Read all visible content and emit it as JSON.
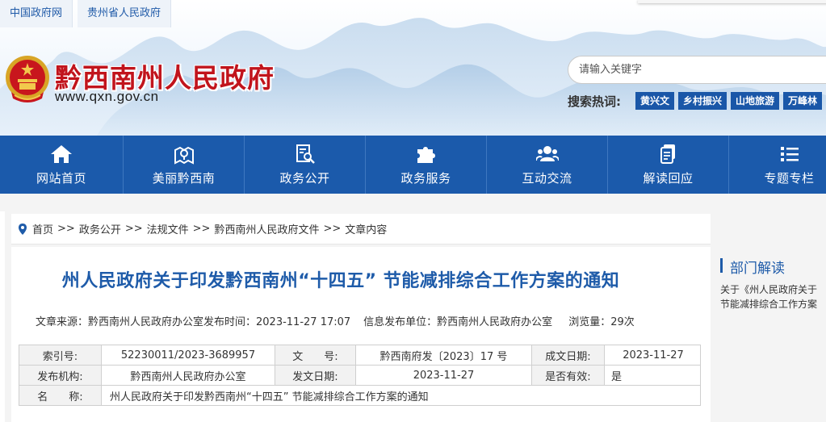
{
  "header": {
    "top_links": [
      "中国政府网",
      "贵州省人民政府"
    ],
    "site_title": "黔西南州人民政府",
    "site_url": "www.qxn.gov.cn",
    "search_placeholder": "请输入关键字",
    "hot_label": "搜索热词:",
    "hot_words": [
      "黄兴文",
      "乡村振兴",
      "山地旅游",
      "万峰林"
    ]
  },
  "nav": [
    {
      "label": "网站首页",
      "icon": "home-icon"
    },
    {
      "label": "美丽黔西南",
      "icon": "map-pin-icon"
    },
    {
      "label": "政务公开",
      "icon": "document-search-icon"
    },
    {
      "label": "政务服务",
      "icon": "puzzle-icon"
    },
    {
      "label": "互动交流",
      "icon": "people-icon"
    },
    {
      "label": "解读回应",
      "icon": "files-icon"
    },
    {
      "label": "专题专栏",
      "icon": "list-icon"
    }
  ],
  "breadcrumb": [
    "首页",
    "政务公开",
    "法规文件",
    "黔西南州人民政府文件",
    "文章内容"
  ],
  "breadcrumb_sep": ">>",
  "article": {
    "title": "州人民政府关于印发黔西南州“十四五” 节能减排综合工作方案的通知",
    "source": "文章来源：黔西南州人民政府办公室",
    "publish_time": "发布时间：2023-11-27 17:07",
    "publisher": "信息发布单位：黔西南州人民政府办公室",
    "views": "浏览量：29次"
  },
  "info_table": {
    "index_label": "索引号:",
    "index_value": "52230011/2023-3689957",
    "doc_no_label": "文　　号:",
    "doc_no_value": "黔西南府发〔2023〕17 号",
    "created_label": "成文日期:",
    "created_value": "2023-11-27",
    "org_label": "发布机构:",
    "org_value": "黔西南州人民政府办公室",
    "issue_label": "发文日期:",
    "issue_value": "2023-11-27",
    "valid_label": "是否有效:",
    "valid_value": "是",
    "name_label": "名　　称:",
    "name_value": "州人民政府关于印发黔西南州“十四五” 节能减排综合工作方案的通知"
  },
  "sidebar": {
    "title": "部门解读",
    "item_line1": "关于《州人民政府关于",
    "item_line2": "节能减排综合工作方案"
  },
  "colors": {
    "brand_blue": "#1b5aab",
    "title_red": "#c1141c",
    "link_blue": "#1e5ba9"
  }
}
